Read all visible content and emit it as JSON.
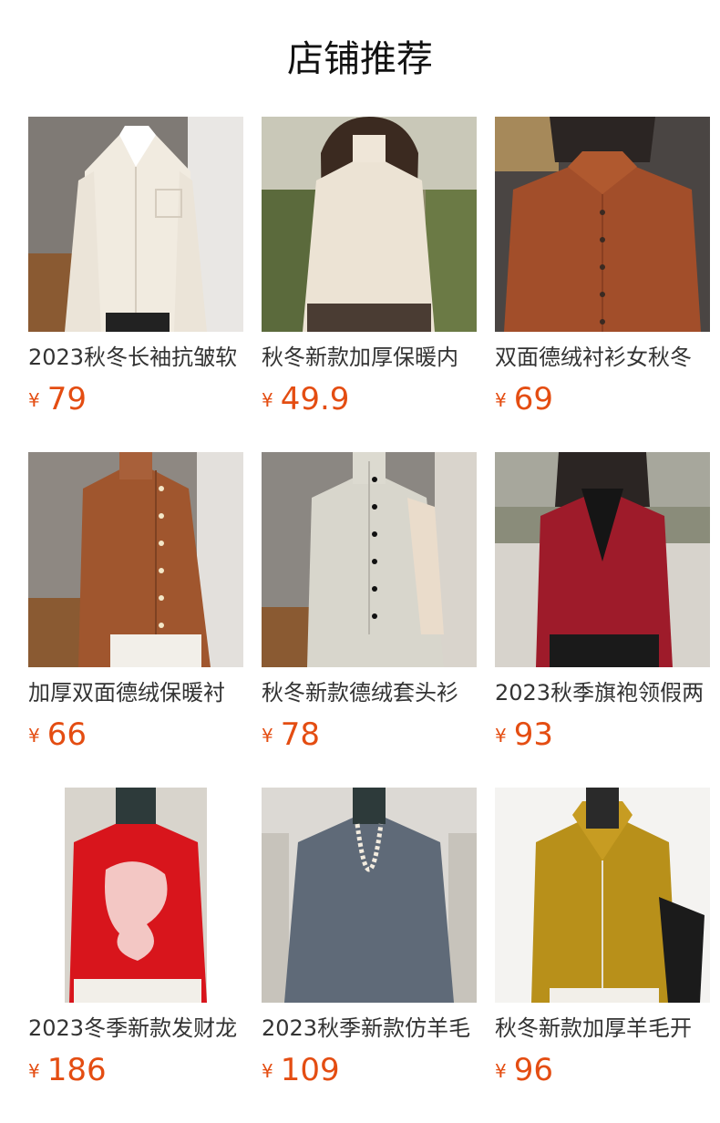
{
  "page": {
    "title": "店铺推荐"
  },
  "currency_symbol": "¥",
  "products": [
    {
      "name": "2023秋冬长袖抗皱软",
      "price": "79"
    },
    {
      "name": "秋冬新款加厚保暖内",
      "price": "49.9"
    },
    {
      "name": "双面德绒衬衫女秋冬",
      "price": "69"
    },
    {
      "name": "加厚双面德绒保暖衬",
      "price": "66"
    },
    {
      "name": "秋冬新款德绒套头衫",
      "price": "78"
    },
    {
      "name": "2023秋季旗袍领假两",
      "price": "93"
    },
    {
      "name": "2023冬季新款发财龙",
      "price": "186"
    },
    {
      "name": "2023秋季新款仿羊毛",
      "price": "109"
    },
    {
      "name": "秋冬新款加厚羊毛开",
      "price": "96"
    }
  ],
  "colors": {
    "price": "#e44d12",
    "garments": [
      "#f1ebe0",
      "#ece3d4",
      "#a24e2a",
      "#a0562e",
      "#d8d6cc",
      "#9e1b2a",
      "#d8151c",
      "#5f6a78",
      "#b8901a"
    ]
  }
}
